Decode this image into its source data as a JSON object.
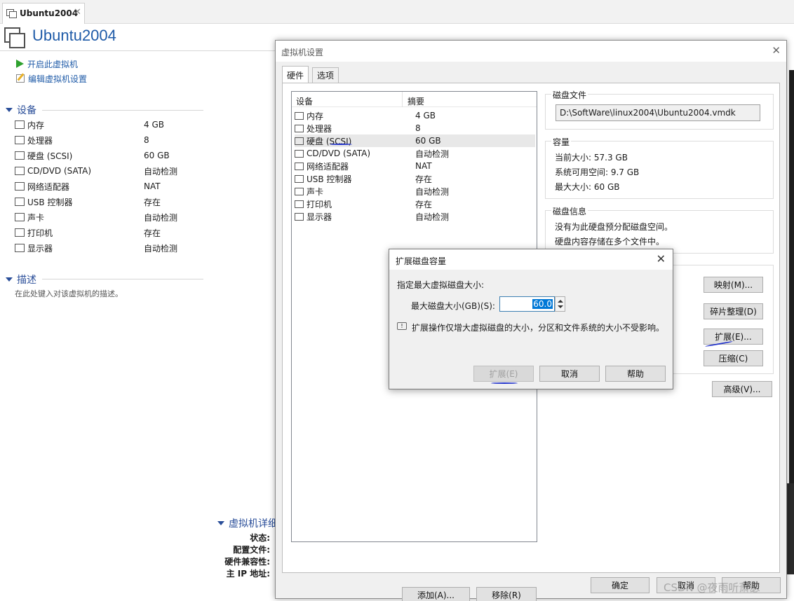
{
  "tab": {
    "title": "Ubuntu2004",
    "close": "✕"
  },
  "vm": {
    "title": "Ubuntu2004"
  },
  "actions": {
    "power_on": "开启此虚拟机",
    "edit_settings": "编辑虚拟机设置"
  },
  "devices_section": {
    "title": "设备"
  },
  "devices": [
    {
      "name": "内存",
      "value": "4 GB",
      "icon": "memory-icon"
    },
    {
      "name": "处理器",
      "value": "8",
      "icon": "cpu-icon"
    },
    {
      "name": "硬盘 (SCSI)",
      "value": "60 GB",
      "icon": "hard-disk-icon"
    },
    {
      "name": "CD/DVD (SATA)",
      "value": "自动检测",
      "icon": "cd-dvd-icon"
    },
    {
      "name": "网络适配器",
      "value": "NAT",
      "icon": "network-icon"
    },
    {
      "name": "USB 控制器",
      "value": "存在",
      "icon": "usb-icon"
    },
    {
      "name": "声卡",
      "value": "自动检测",
      "icon": "sound-icon"
    },
    {
      "name": "打印机",
      "value": "存在",
      "icon": "printer-icon"
    },
    {
      "name": "显示器",
      "value": "自动检测",
      "icon": "display-icon"
    }
  ],
  "description": {
    "title": "描述",
    "placeholder": "在此处键入对该虚拟机的描述。"
  },
  "details": {
    "title": "虚拟机详细",
    "labels": [
      "状态:",
      "配置文件:",
      "硬件兼容性:",
      "主 IP 地址:"
    ]
  },
  "settings_dialog": {
    "title": "虚拟机设置",
    "close": "✕",
    "tabs": [
      "硬件",
      "选项"
    ],
    "list_headers": {
      "device": "设备",
      "summary": "摘要"
    },
    "add_button": "添加(A)...",
    "remove_button": "移除(R)",
    "disk_file": {
      "label": "磁盘文件",
      "path": "D:\\SoftWare\\linux2004\\Ubuntu2004.vmdk"
    },
    "capacity": {
      "label": "容量",
      "current": "当前大小: 57.3 GB",
      "available": "系统可用空间: 9.7 GB",
      "maximum": "最大大小: 60 GB"
    },
    "disk_info": {
      "label": "磁盘信息",
      "line1": "没有为此硬盘预分配磁盘空间。",
      "line2": "硬盘内容存储在多个文件中。"
    },
    "utilities": {
      "map": "映射(M)...",
      "defrag": "碎片整理(D)",
      "expand": "扩展(E)...",
      "compact": "压缩(C)"
    },
    "advanced": "高级(V)...",
    "ok": "确定",
    "cancel": "取消",
    "help": "帮助"
  },
  "expand_dialog": {
    "title": "扩展磁盘容量",
    "close": "✕",
    "prompt": "指定最大虚拟磁盘大小:",
    "size_label": "最大磁盘大小(GB)(S):",
    "size_value": "60.0",
    "info": "扩展操作仅增大虚拟磁盘的大小，分区和文件系统的大小不受影响。",
    "expand_button": "扩展(E)",
    "cancel_button": "取消",
    "help_button": "帮助"
  },
  "watermark": "CSDN @夜雨听萧瑟"
}
